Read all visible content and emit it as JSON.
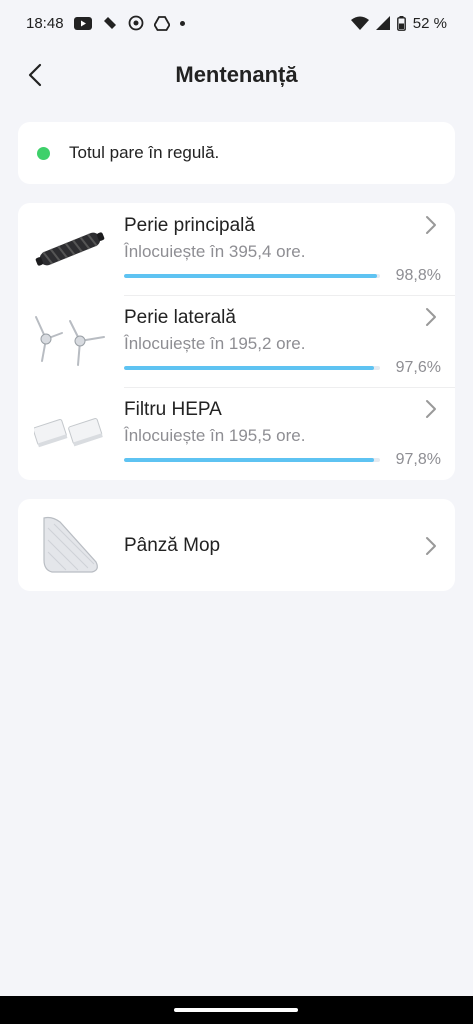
{
  "status_bar": {
    "time": "18:48",
    "battery": "52 %",
    "icons": [
      "youtube-icon",
      "tidal-icon",
      "camera-target-icon",
      "drive-icon",
      "dot-icon",
      "wifi-icon",
      "signal-icon",
      "battery-icon"
    ]
  },
  "header": {
    "title": "Mentenanță",
    "back_icon": "chevron-left-icon"
  },
  "status": {
    "text": "Totul pare în regulă.",
    "color": "#3ed06a"
  },
  "items": [
    {
      "name": "Perie principală",
      "sub": "Înlocuiește în 395,4 ore.",
      "pct": "98,8%",
      "fill": 0.988
    },
    {
      "name": "Perie laterală",
      "sub": "Înlocuiește în 195,2 ore.",
      "pct": "97,6%",
      "fill": 0.976
    },
    {
      "name": "Filtru HEPA",
      "sub": "Înlocuiește în 195,5 ore.",
      "pct": "97,8%",
      "fill": 0.978
    }
  ],
  "mop": {
    "name": "Pânză Mop"
  },
  "colors": {
    "accent": "#5ec3f2",
    "background": "#f4f5f9"
  }
}
